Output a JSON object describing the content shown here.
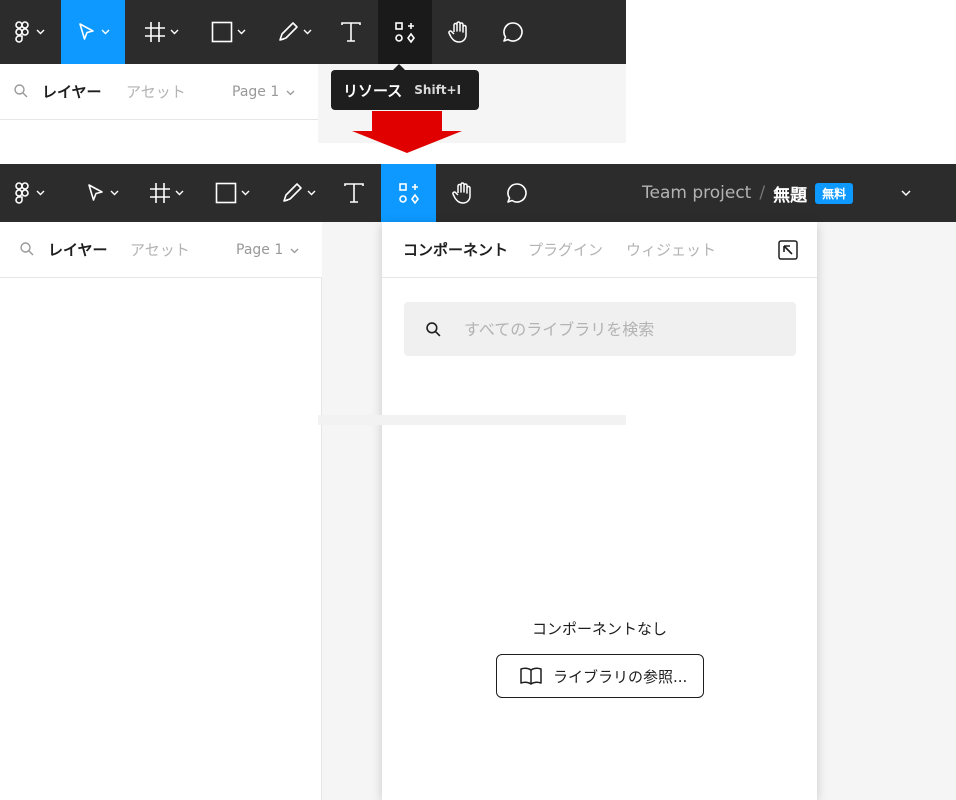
{
  "top": {
    "tooltip": {
      "label": "リソース",
      "shortcut": "Shift+I"
    },
    "left_panel": {
      "tabs": [
        "レイヤー",
        "アセット"
      ],
      "page": "Page 1"
    }
  },
  "bottom": {
    "left_panel": {
      "tabs": [
        "レイヤー",
        "アセット"
      ],
      "page": "Page 1"
    },
    "header": {
      "project": "Team project",
      "separator": "/",
      "file": "無題",
      "badge": "無料"
    },
    "resources": {
      "tabs": [
        "コンポーネント",
        "プラグイン",
        "ウィジェット"
      ],
      "search_placeholder": "すべてのライブラリを検索",
      "empty_text": "コンポーネントなし",
      "browse_label": "ライブラリの参照..."
    }
  },
  "colors": {
    "toolbar": "#2c2c2c",
    "accent": "#0d99ff",
    "active_dark": "#1e1e1e",
    "badge": "#0d99ff"
  },
  "icons": [
    "figma-menu-icon",
    "move-tool-icon",
    "frame-tool-icon",
    "shape-tool-icon",
    "pen-tool-icon",
    "text-tool-icon",
    "resources-icon",
    "hand-tool-icon",
    "comment-tool-icon",
    "search-icon",
    "chevron-down-icon",
    "arrow-up-left-icon",
    "book-icon"
  ]
}
